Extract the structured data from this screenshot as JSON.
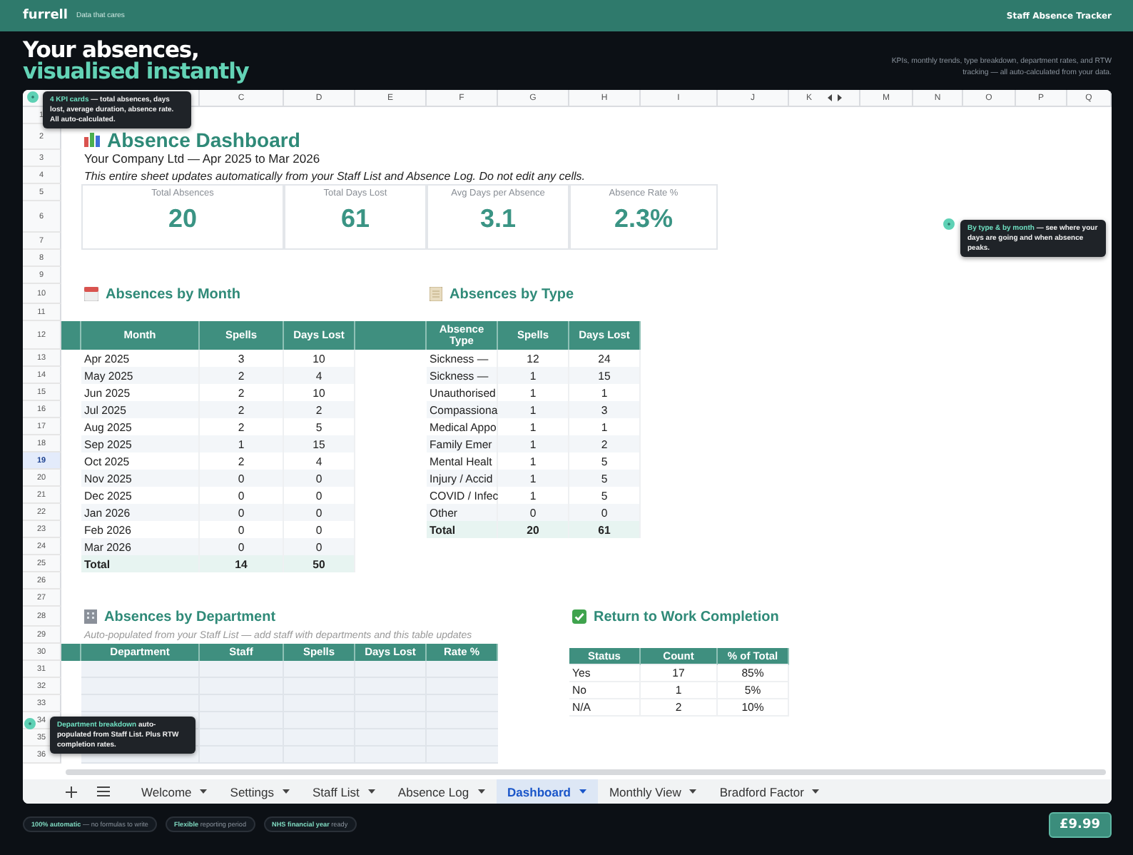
{
  "top_bar": {
    "brand": "furrell",
    "tagline": "Data that cares",
    "product": "Staff Absence Tracker"
  },
  "hero": {
    "headline": [
      "Your absences,",
      "visualised instantly"
    ],
    "description": "KPIs, monthly trends, type breakdown, department rates, and RTW tracking — all auto-calculated from your data."
  },
  "sheet": {
    "columns": [
      {
        "letter": "C"
      },
      {
        "letter": "D"
      },
      {
        "letter": "E"
      },
      {
        "letter": "F"
      },
      {
        "letter": "G"
      },
      {
        "letter": "H"
      },
      {
        "letter": "I"
      },
      {
        "letter": "J"
      },
      {
        "letter": "K"
      },
      {
        "letter": "M"
      },
      {
        "letter": "N"
      },
      {
        "letter": "O"
      },
      {
        "letter": "P"
      },
      {
        "letter": "Q"
      }
    ],
    "rows": [
      {
        "number": "1",
        "selected": false
      },
      {
        "number": "2",
        "selected": false
      },
      {
        "number": "3",
        "selected": false
      },
      {
        "number": "4",
        "selected": false
      },
      {
        "number": "5",
        "selected": false
      },
      {
        "number": "6",
        "selected": false
      },
      {
        "number": "7",
        "selected": false
      },
      {
        "number": "8",
        "selected": false
      },
      {
        "number": "9",
        "selected": false
      },
      {
        "number": "10",
        "selected": false
      },
      {
        "number": "11",
        "selected": false
      },
      {
        "number": "12",
        "selected": false
      },
      {
        "number": "13",
        "selected": false
      },
      {
        "number": "14",
        "selected": false
      },
      {
        "number": "15",
        "selected": false
      },
      {
        "number": "16",
        "selected": false
      },
      {
        "number": "17",
        "selected": false
      },
      {
        "number": "18",
        "selected": false
      },
      {
        "number": "19",
        "selected": true
      },
      {
        "number": "20",
        "selected": false
      },
      {
        "number": "21",
        "selected": false
      },
      {
        "number": "22",
        "selected": false
      },
      {
        "number": "23",
        "selected": false
      },
      {
        "number": "24",
        "selected": false
      },
      {
        "number": "25",
        "selected": false
      },
      {
        "number": "26",
        "selected": false
      },
      {
        "number": "27",
        "selected": false
      },
      {
        "number": "28",
        "selected": false
      },
      {
        "number": "29",
        "selected": false
      },
      {
        "number": "30",
        "selected": false
      },
      {
        "number": "31",
        "selected": false
      },
      {
        "number": "32",
        "selected": false
      },
      {
        "number": "33",
        "selected": false
      },
      {
        "number": "34",
        "selected": false
      },
      {
        "number": "35",
        "selected": false
      },
      {
        "number": "36",
        "selected": false
      }
    ],
    "title": "Absence Dashboard",
    "company": "Your Company Ltd — Apr 2025 to Mar 2026",
    "note": "This entire sheet updates automatically from your Staff List and Absence Log. Do not edit any cells.",
    "kpis": [
      {
        "label": "Total Absences",
        "value": "20"
      },
      {
        "label": "Total Days Lost",
        "value": "61"
      },
      {
        "label": "Avg Days per Absence",
        "value": "3.1"
      },
      {
        "label": "Absence Rate %",
        "value": "2.3%"
      }
    ],
    "by_month": {
      "title": "Absences by Month",
      "columns": [
        "Month",
        "Spells",
        "Days Lost"
      ],
      "rows": [
        [
          "Apr 2025",
          "3",
          "10"
        ],
        [
          "May 2025",
          "2",
          "4"
        ],
        [
          "Jun 2025",
          "2",
          "10"
        ],
        [
          "Jul 2025",
          "2",
          "2"
        ],
        [
          "Aug 2025",
          "2",
          "5"
        ],
        [
          "Sep 2025",
          "1",
          "15"
        ],
        [
          "Oct 2025",
          "2",
          "4"
        ],
        [
          "Nov 2025",
          "0",
          "0"
        ],
        [
          "Dec 2025",
          "0",
          "0"
        ],
        [
          "Jan 2026",
          "0",
          "0"
        ],
        [
          "Feb 2026",
          "0",
          "0"
        ],
        [
          "Mar 2026",
          "0",
          "0"
        ]
      ],
      "total": [
        "Total",
        "14",
        "50"
      ]
    },
    "by_type": {
      "title": "Absences by Type",
      "columns": [
        "Absence Type",
        "Spells",
        "Days Lost"
      ],
      "rows": [
        [
          "Sickness —",
          "12",
          "24"
        ],
        [
          "Sickness —",
          "1",
          "15"
        ],
        [
          "Unauthorised",
          "1",
          "1"
        ],
        [
          "Compassiona",
          "1",
          "3"
        ],
        [
          "Medical Appo",
          "1",
          "1"
        ],
        [
          "Family Emer",
          "1",
          "2"
        ],
        [
          "Mental Healt",
          "1",
          "5"
        ],
        [
          "Injury / Accid",
          "1",
          "5"
        ],
        [
          "COVID / Infec",
          "1",
          "5"
        ],
        [
          "Other",
          "0",
          "0"
        ]
      ],
      "total": [
        "Total",
        "20",
        "61"
      ]
    },
    "by_department": {
      "title": "Absences by Department",
      "subtitle": "Auto-populated from your Staff List — add staff with departments and this table updates",
      "columns": [
        "Department",
        "Staff",
        "Spells",
        "Days Lost",
        "Rate %"
      ]
    },
    "rtw": {
      "title": "Return to Work Completion",
      "columns": [
        "Status",
        "Count",
        "% of Total"
      ],
      "rows": [
        [
          "Yes",
          "17",
          "85%"
        ],
        [
          "No",
          "1",
          "5%"
        ],
        [
          "N/A",
          "2",
          "10%"
        ]
      ]
    }
  },
  "tips": [
    {
      "text": "**4 KPI cards** — total absences, days lost, average duration, absence rate. All auto-calculated."
    },
    {
      "text": "**By type & by month** — see where your days are going and when absence peaks."
    },
    {
      "text": "**Department breakdown** auto-populated from Staff List. Plus RTW completion rates."
    }
  ],
  "sheet_tabs": [
    {
      "label": "Welcome",
      "selected": false
    },
    {
      "label": "Settings",
      "selected": false
    },
    {
      "label": "Staff List",
      "selected": false
    },
    {
      "label": "Absence Log",
      "selected": false
    },
    {
      "label": "Dashboard",
      "selected": true
    },
    {
      "label": "Monthly View",
      "selected": false
    },
    {
      "label": "Bradford Factor",
      "selected": false
    }
  ],
  "footer": {
    "badges": [
      "**100% automatic** — no formulas to write",
      "**Flexible** reporting period",
      "**NHS financial year** ready"
    ],
    "price": "£9.99"
  }
}
